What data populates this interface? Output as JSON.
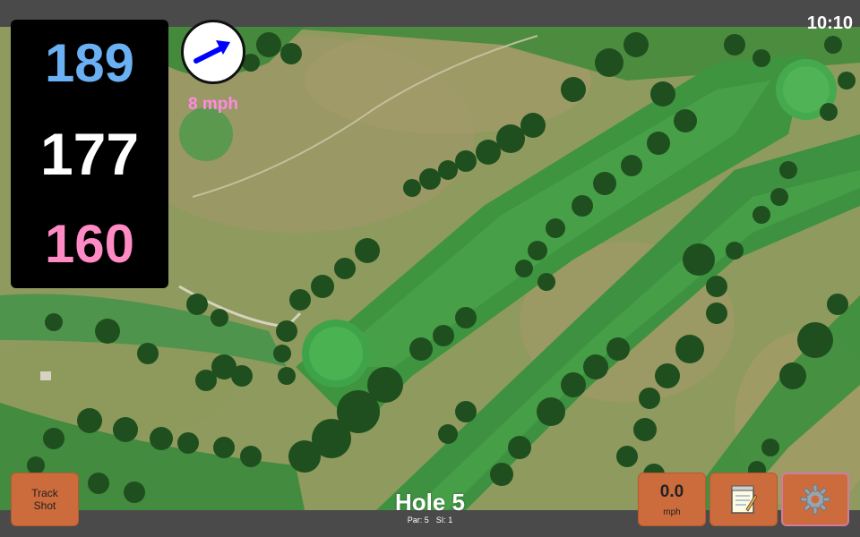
{
  "clock": "10:10",
  "yardages": {
    "back": "189",
    "center": "177",
    "front": "160"
  },
  "wind": {
    "speed_label": "8 mph",
    "icon": "wind-arrow-icon"
  },
  "track_button": {
    "line1": "Track",
    "line2": "Shot"
  },
  "speed_button": {
    "value": "0.0",
    "unit": "mph"
  },
  "notes_button": {
    "icon": "notepad-icon"
  },
  "settings_button": {
    "icon": "gear-icon"
  },
  "hole": {
    "title": "Hole 5",
    "par": "Par: 5",
    "si": "SI: 1"
  },
  "colors": {
    "back_yardage": "#6ab0f3",
    "center_yardage": "#ffffff",
    "front_yardage": "#ff8ac4",
    "wind_speed": "#ff8ae2",
    "button": "#cc6b3c",
    "arrow": "#0000ff",
    "bar": "#4a4a4a"
  }
}
